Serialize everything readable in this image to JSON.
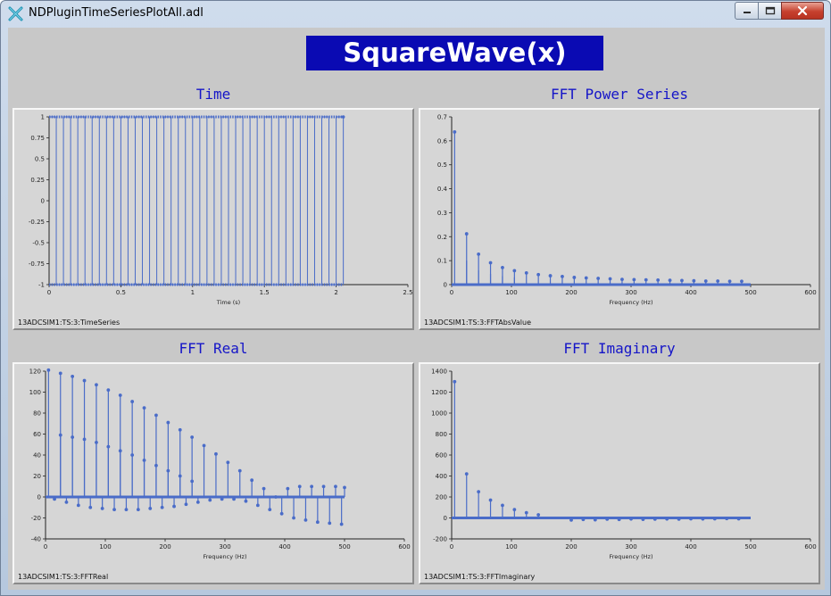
{
  "window": {
    "title": "NDPluginTimeSeriesPlotAll.adl",
    "icon": "medm-x-icon",
    "title_color": "#000000"
  },
  "main_title": {
    "text": "SquareWave(x)",
    "background": "#0a0ab3",
    "color": "#ffffff"
  },
  "colors": {
    "heading": "#1515c8",
    "trace": "#4a6cc8",
    "panel_background": "#d6d6d6",
    "client_background": "#c8c8c8"
  },
  "plots": [
    {
      "heading": "Time",
      "pv_label": "13ADCSIM1:TS:3:TimeSeries",
      "chart_data": {
        "type": "line",
        "title": "",
        "xlabel": "Time (s)",
        "ylabel": "",
        "xlim": [
          0,
          2.5
        ],
        "ylim": [
          -1,
          1
        ],
        "xticks": [
          0,
          0.5,
          1,
          1.5,
          2,
          2.5
        ],
        "yticks": [
          -1,
          -0.75,
          -0.5,
          -0.25,
          0,
          0.25,
          0.5,
          0.75,
          1
        ],
        "ytick_labels": [
          "-1",
          "-0.75",
          "-0.5",
          "-0.25",
          "0",
          "0.25",
          "0.5",
          "0.75",
          "1"
        ],
        "series": [
          {
            "signal": "square",
            "period_s": 0.1,
            "low": -1,
            "high": 1,
            "x_start": 0,
            "x_end": 2.05
          }
        ]
      }
    },
    {
      "heading": "FFT Power Series",
      "pv_label": "13ADCSIM1:TS:3:FFTAbsValue",
      "chart_data": {
        "type": "stem",
        "title": "",
        "xlabel": "Frequency (Hz)",
        "ylabel": "",
        "xlim": [
          0,
          600
        ],
        "ylim": [
          0,
          0.7
        ],
        "xticks": [
          0,
          100,
          200,
          300,
          400,
          500,
          600
        ],
        "yticks": [
          0,
          0.1,
          0.2,
          0.3,
          0.4,
          0.5,
          0.6,
          0.7
        ],
        "ytick_labels": [
          "0",
          "0.1",
          "0.2",
          "0.3",
          "0.4",
          "0.5",
          "0.6",
          "0.7"
        ],
        "x_max": 500,
        "primary": {
          "x": [
            5,
            25,
            45,
            65,
            85,
            105,
            125,
            145,
            165,
            185,
            205,
            225,
            245,
            265,
            285,
            305,
            325,
            345,
            365,
            385,
            405,
            425,
            445,
            465,
            485
          ],
          "y": [
            0.637,
            0.212,
            0.127,
            0.091,
            0.071,
            0.058,
            0.049,
            0.042,
            0.037,
            0.034,
            0.03,
            0.028,
            0.026,
            0.024,
            0.022,
            0.021,
            0.02,
            0.019,
            0.018,
            0.017,
            0.016,
            0.015,
            0.015,
            0.014,
            0.014
          ]
        },
        "secondary": {
          "x": [
            25,
            45,
            65,
            85,
            105
          ],
          "y": [
            0.1,
            0.06,
            0.045,
            0.035,
            0.03
          ]
        }
      }
    },
    {
      "heading": "FFT Real",
      "pv_label": "13ADCSIM1:TS:3:FFTReal",
      "chart_data": {
        "type": "stem",
        "title": "",
        "xlabel": "Frequency (Hz)",
        "ylabel": "",
        "xlim": [
          0,
          600
        ],
        "ylim": [
          -40,
          120
        ],
        "xticks": [
          0,
          100,
          200,
          300,
          400,
          500,
          600
        ],
        "yticks": [
          -40,
          -20,
          0,
          20,
          40,
          60,
          80,
          100,
          120
        ],
        "ytick_labels": [
          "-40",
          "-20",
          "0",
          "20",
          "40",
          "60",
          "80",
          "100",
          "120"
        ],
        "x_max": 500,
        "primary": {
          "x": [
            5,
            25,
            45,
            65,
            85,
            105,
            125,
            145,
            165,
            185,
            205,
            225,
            245,
            265,
            285,
            305,
            325,
            345,
            365,
            385,
            405,
            425,
            445,
            465,
            485,
            500
          ],
          "y": [
            121,
            118,
            115,
            111,
            107,
            102,
            97,
            91,
            85,
            78,
            71,
            64,
            57,
            49,
            41,
            33,
            25,
            16,
            8,
            0,
            8,
            10,
            10,
            10,
            10,
            9
          ]
        },
        "secondary": {
          "x": [
            25,
            45,
            65,
            85,
            105,
            125,
            145,
            165,
            185,
            205,
            225,
            245
          ],
          "y": [
            59,
            57,
            55,
            52,
            48,
            44,
            40,
            35,
            30,
            25,
            20,
            15
          ]
        },
        "tertiary": {
          "x": [
            15,
            35,
            55,
            75,
            95,
            115,
            135,
            155,
            175,
            195,
            215,
            235,
            255,
            275,
            295,
            315,
            335,
            355,
            375,
            395,
            415,
            435,
            455,
            475,
            495
          ],
          "y": [
            -2,
            -5,
            -8,
            -10,
            -11,
            -12,
            -12,
            -12,
            -11,
            -10,
            -9,
            -7,
            -5,
            -3,
            -2,
            -2,
            -4,
            -8,
            -12,
            -16,
            -20,
            -22,
            -24,
            -25,
            -26
          ]
        }
      }
    },
    {
      "heading": "FFT Imaginary",
      "pv_label": "13ADCSIM1:TS:3:FFTImaginary",
      "chart_data": {
        "type": "stem",
        "title": "",
        "xlabel": "Frequency (Hz)",
        "ylabel": "",
        "xlim": [
          0,
          600
        ],
        "ylim": [
          -200,
          1400
        ],
        "xticks": [
          0,
          100,
          200,
          300,
          400,
          500,
          600
        ],
        "yticks": [
          -200,
          0,
          200,
          400,
          600,
          800,
          1000,
          1200,
          1400
        ],
        "ytick_labels": [
          "-200",
          "0",
          "200",
          "400",
          "600",
          "800",
          "1000",
          "1200",
          "1400"
        ],
        "x_max": 500,
        "primary": {
          "x": [
            5,
            25,
            45,
            65,
            85,
            105,
            125,
            145
          ],
          "y": [
            1300,
            420,
            250,
            170,
            120,
            80,
            50,
            30
          ]
        },
        "secondary": {
          "x": [
            200,
            220,
            240,
            260,
            280,
            300,
            320,
            340,
            360,
            380,
            400,
            420,
            440,
            460,
            480
          ],
          "y": [
            -20,
            -15,
            -18,
            -12,
            -15,
            -10,
            -14,
            -12,
            -10,
            -12,
            -8,
            -10,
            -8,
            -6,
            -8
          ]
        }
      }
    }
  ]
}
